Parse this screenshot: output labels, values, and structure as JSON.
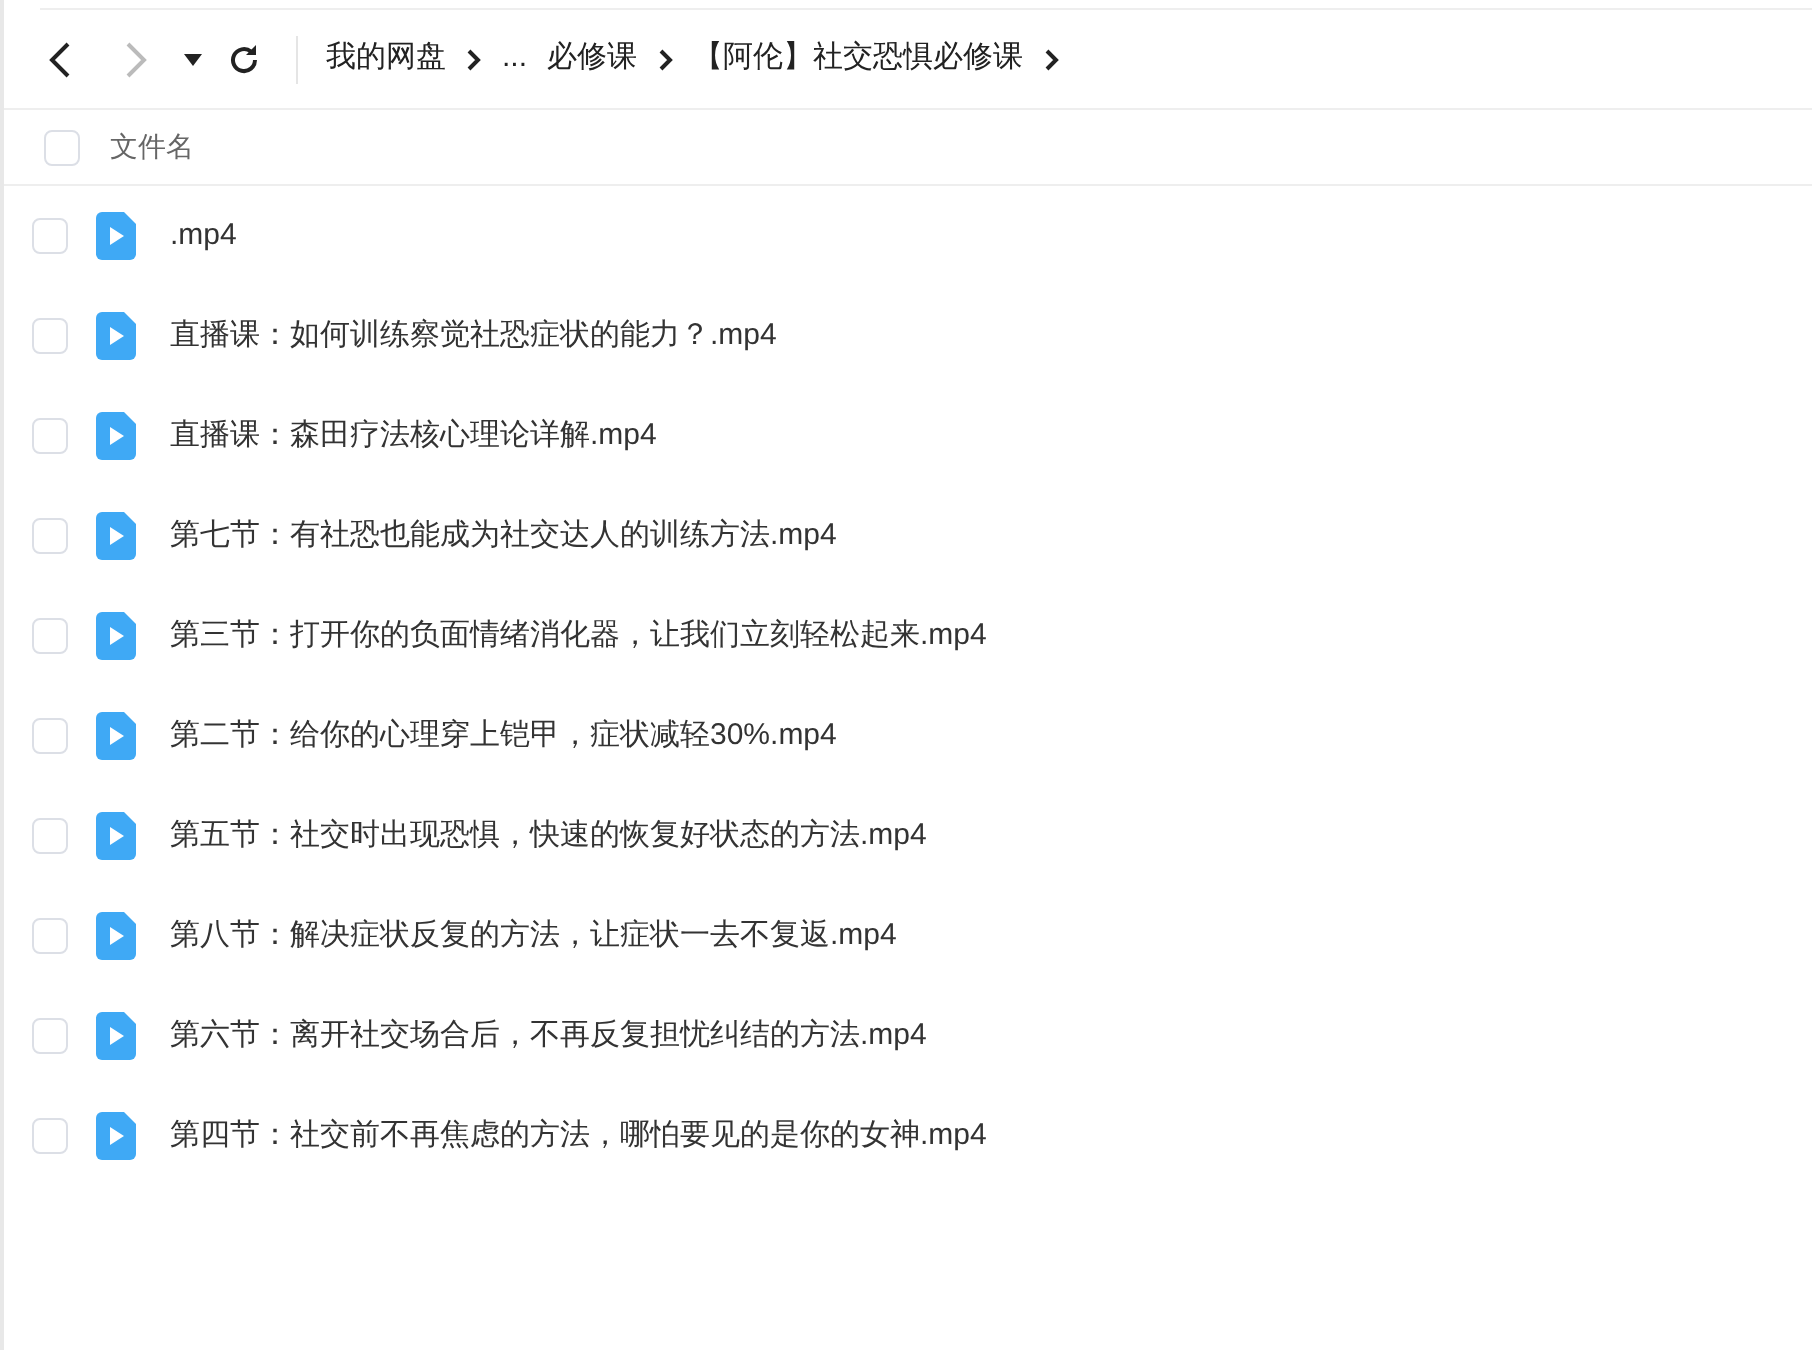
{
  "toolbar": {
    "back": {
      "disabled": false
    },
    "forward": {
      "disabled": true
    }
  },
  "breadcrumb": [
    {
      "label": "我的网盘"
    },
    {
      "label": "..."
    },
    {
      "label": "必修课"
    },
    {
      "label": "【阿伦】社交恐惧必修课"
    }
  ],
  "table": {
    "header": {
      "checked": false,
      "label": "文件名"
    },
    "rows": [
      {
        "name": ".mp4",
        "checked": false
      },
      {
        "name": "直播课：如何训练察觉社恐症状的能力？.mp4",
        "checked": false
      },
      {
        "name": "直播课：森田疗法核心理论详解.mp4",
        "checked": false
      },
      {
        "name": "第七节：有社恐也能成为社交达人的训练方法.mp4",
        "checked": false
      },
      {
        "name": "第三节：打开你的负面情绪消化器，让我们立刻轻松起来.mp4",
        "checked": false
      },
      {
        "name": "第二节：给你的心理穿上铠甲，症状减轻30%.mp4",
        "checked": false
      },
      {
        "name": "第五节：社交时出现恐惧，快速的恢复好状态的方法.mp4",
        "checked": false
      },
      {
        "name": "第八节：解决症状反复的方法，让症状一去不复返.mp4",
        "checked": false
      },
      {
        "name": "第六节：离开社交场合后，不再反复担忧纠结的方法.mp4",
        "checked": false
      },
      {
        "name": "第四节：社交前不再焦虑的方法，哪怕要见的是你的女神.mp4",
        "checked": false
      }
    ]
  }
}
